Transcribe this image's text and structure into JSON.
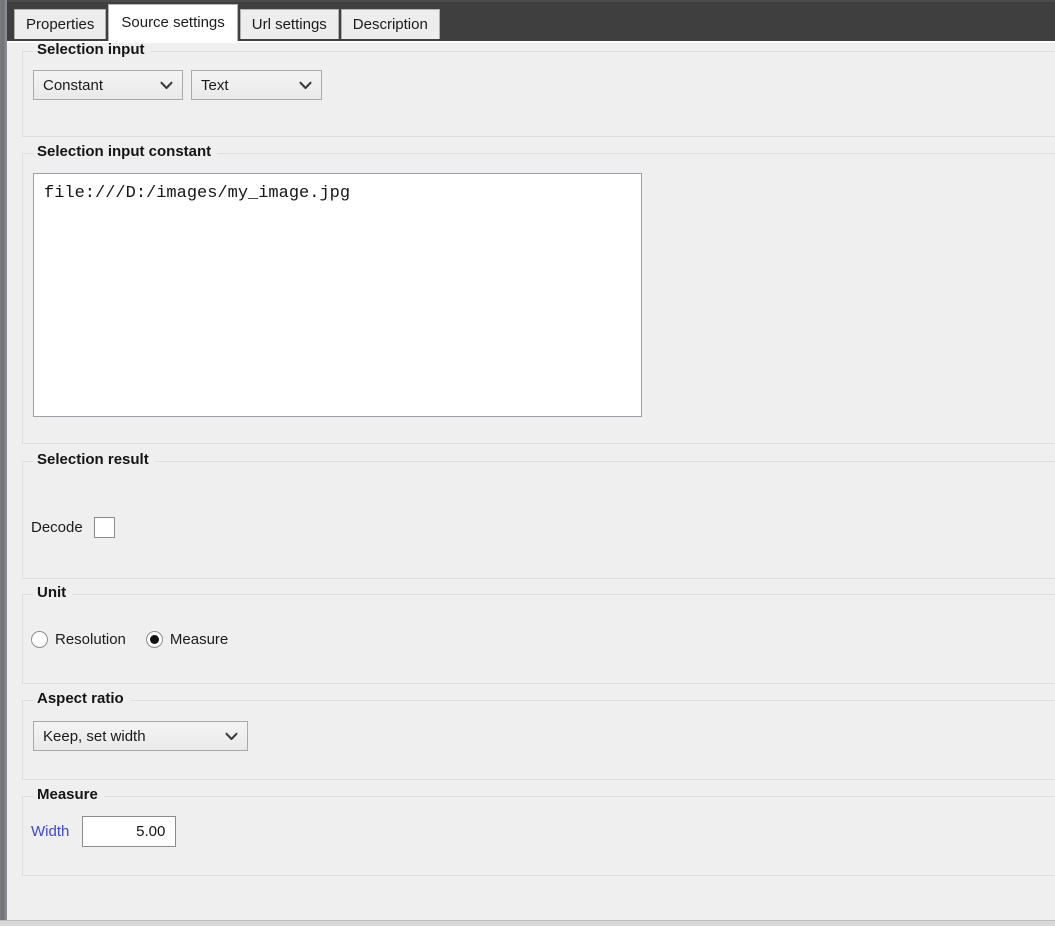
{
  "window": {
    "tab_bar_bg": "#3f3f3f",
    "content_bg": "#efefef"
  },
  "tabs": [
    {
      "label": "Properties",
      "selected": false
    },
    {
      "label": "Source settings",
      "selected": true
    },
    {
      "label": "Url settings",
      "selected": false
    },
    {
      "label": "Description",
      "selected": false
    }
  ],
  "groups": {
    "selection_input": {
      "title": "Selection input",
      "source_combo": {
        "value": "Constant",
        "icon": "chevron-down-icon"
      },
      "type_combo": {
        "value": "Text",
        "icon": "chevron-down-icon"
      }
    },
    "selection_input_constant": {
      "title": "Selection input constant",
      "textarea": {
        "value": "file:///D:/images/my_image.jpg",
        "placeholder": ""
      }
    },
    "selection_result": {
      "title": "Selection result",
      "decode_label": "Decode",
      "decode_checked": false
    },
    "unit": {
      "title": "Unit",
      "options": [
        {
          "label": "Resolution",
          "selected": false
        },
        {
          "label": "Measure",
          "selected": true
        }
      ]
    },
    "aspect_ratio": {
      "title": "Aspect ratio",
      "combo": {
        "value": "Keep, set width",
        "icon": "chevron-down-icon"
      }
    },
    "measure": {
      "title": "Measure",
      "width_label": "Width",
      "width_label_color": "#3f48cc",
      "width_value": "5.00"
    }
  }
}
